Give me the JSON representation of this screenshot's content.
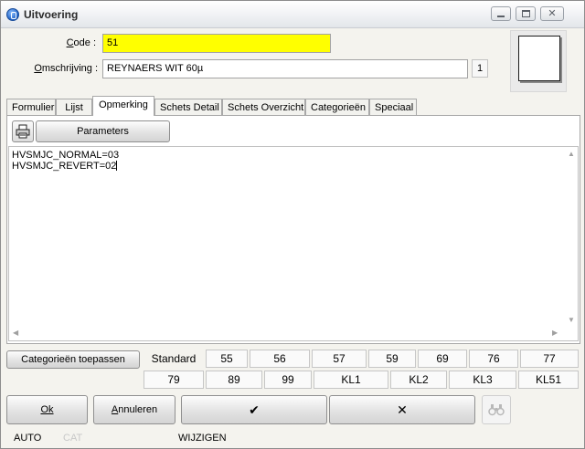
{
  "window": {
    "title": "Uitvoering"
  },
  "form": {
    "code_label": "Code :",
    "code_value": "51",
    "desc_label": "Omschrijving :",
    "desc_value": "REYNAERS WIT 60µ",
    "count_badge": "1"
  },
  "tabs": [
    "Formulier",
    "Lijst",
    "Opmerking",
    "Schets Detail",
    "Schets Overzicht",
    "Categorieën",
    "Speciaal"
  ],
  "active_tab": "Opmerking",
  "toolbar": {
    "parameters_label": "Parameters"
  },
  "editor": {
    "lines": [
      "HVSMJC_NORMAL=03",
      "HVSMJC_REVERT=02"
    ]
  },
  "categories": {
    "apply_label": "Categorieën toepassen",
    "row1": [
      "Standard",
      "55",
      "56",
      "57",
      "59",
      "69",
      "76",
      "77"
    ],
    "row2": [
      "79",
      "89",
      "99",
      "KL1",
      "KL2",
      "KL3",
      "KL51"
    ]
  },
  "buttons": {
    "ok_label": "Ok",
    "cancel_label": "Annuleren",
    "confirm_glyph": "✔",
    "discard_glyph": "✕"
  },
  "status": {
    "mode": "AUTO",
    "cat": "CAT",
    "state": "WIJZIGEN"
  }
}
